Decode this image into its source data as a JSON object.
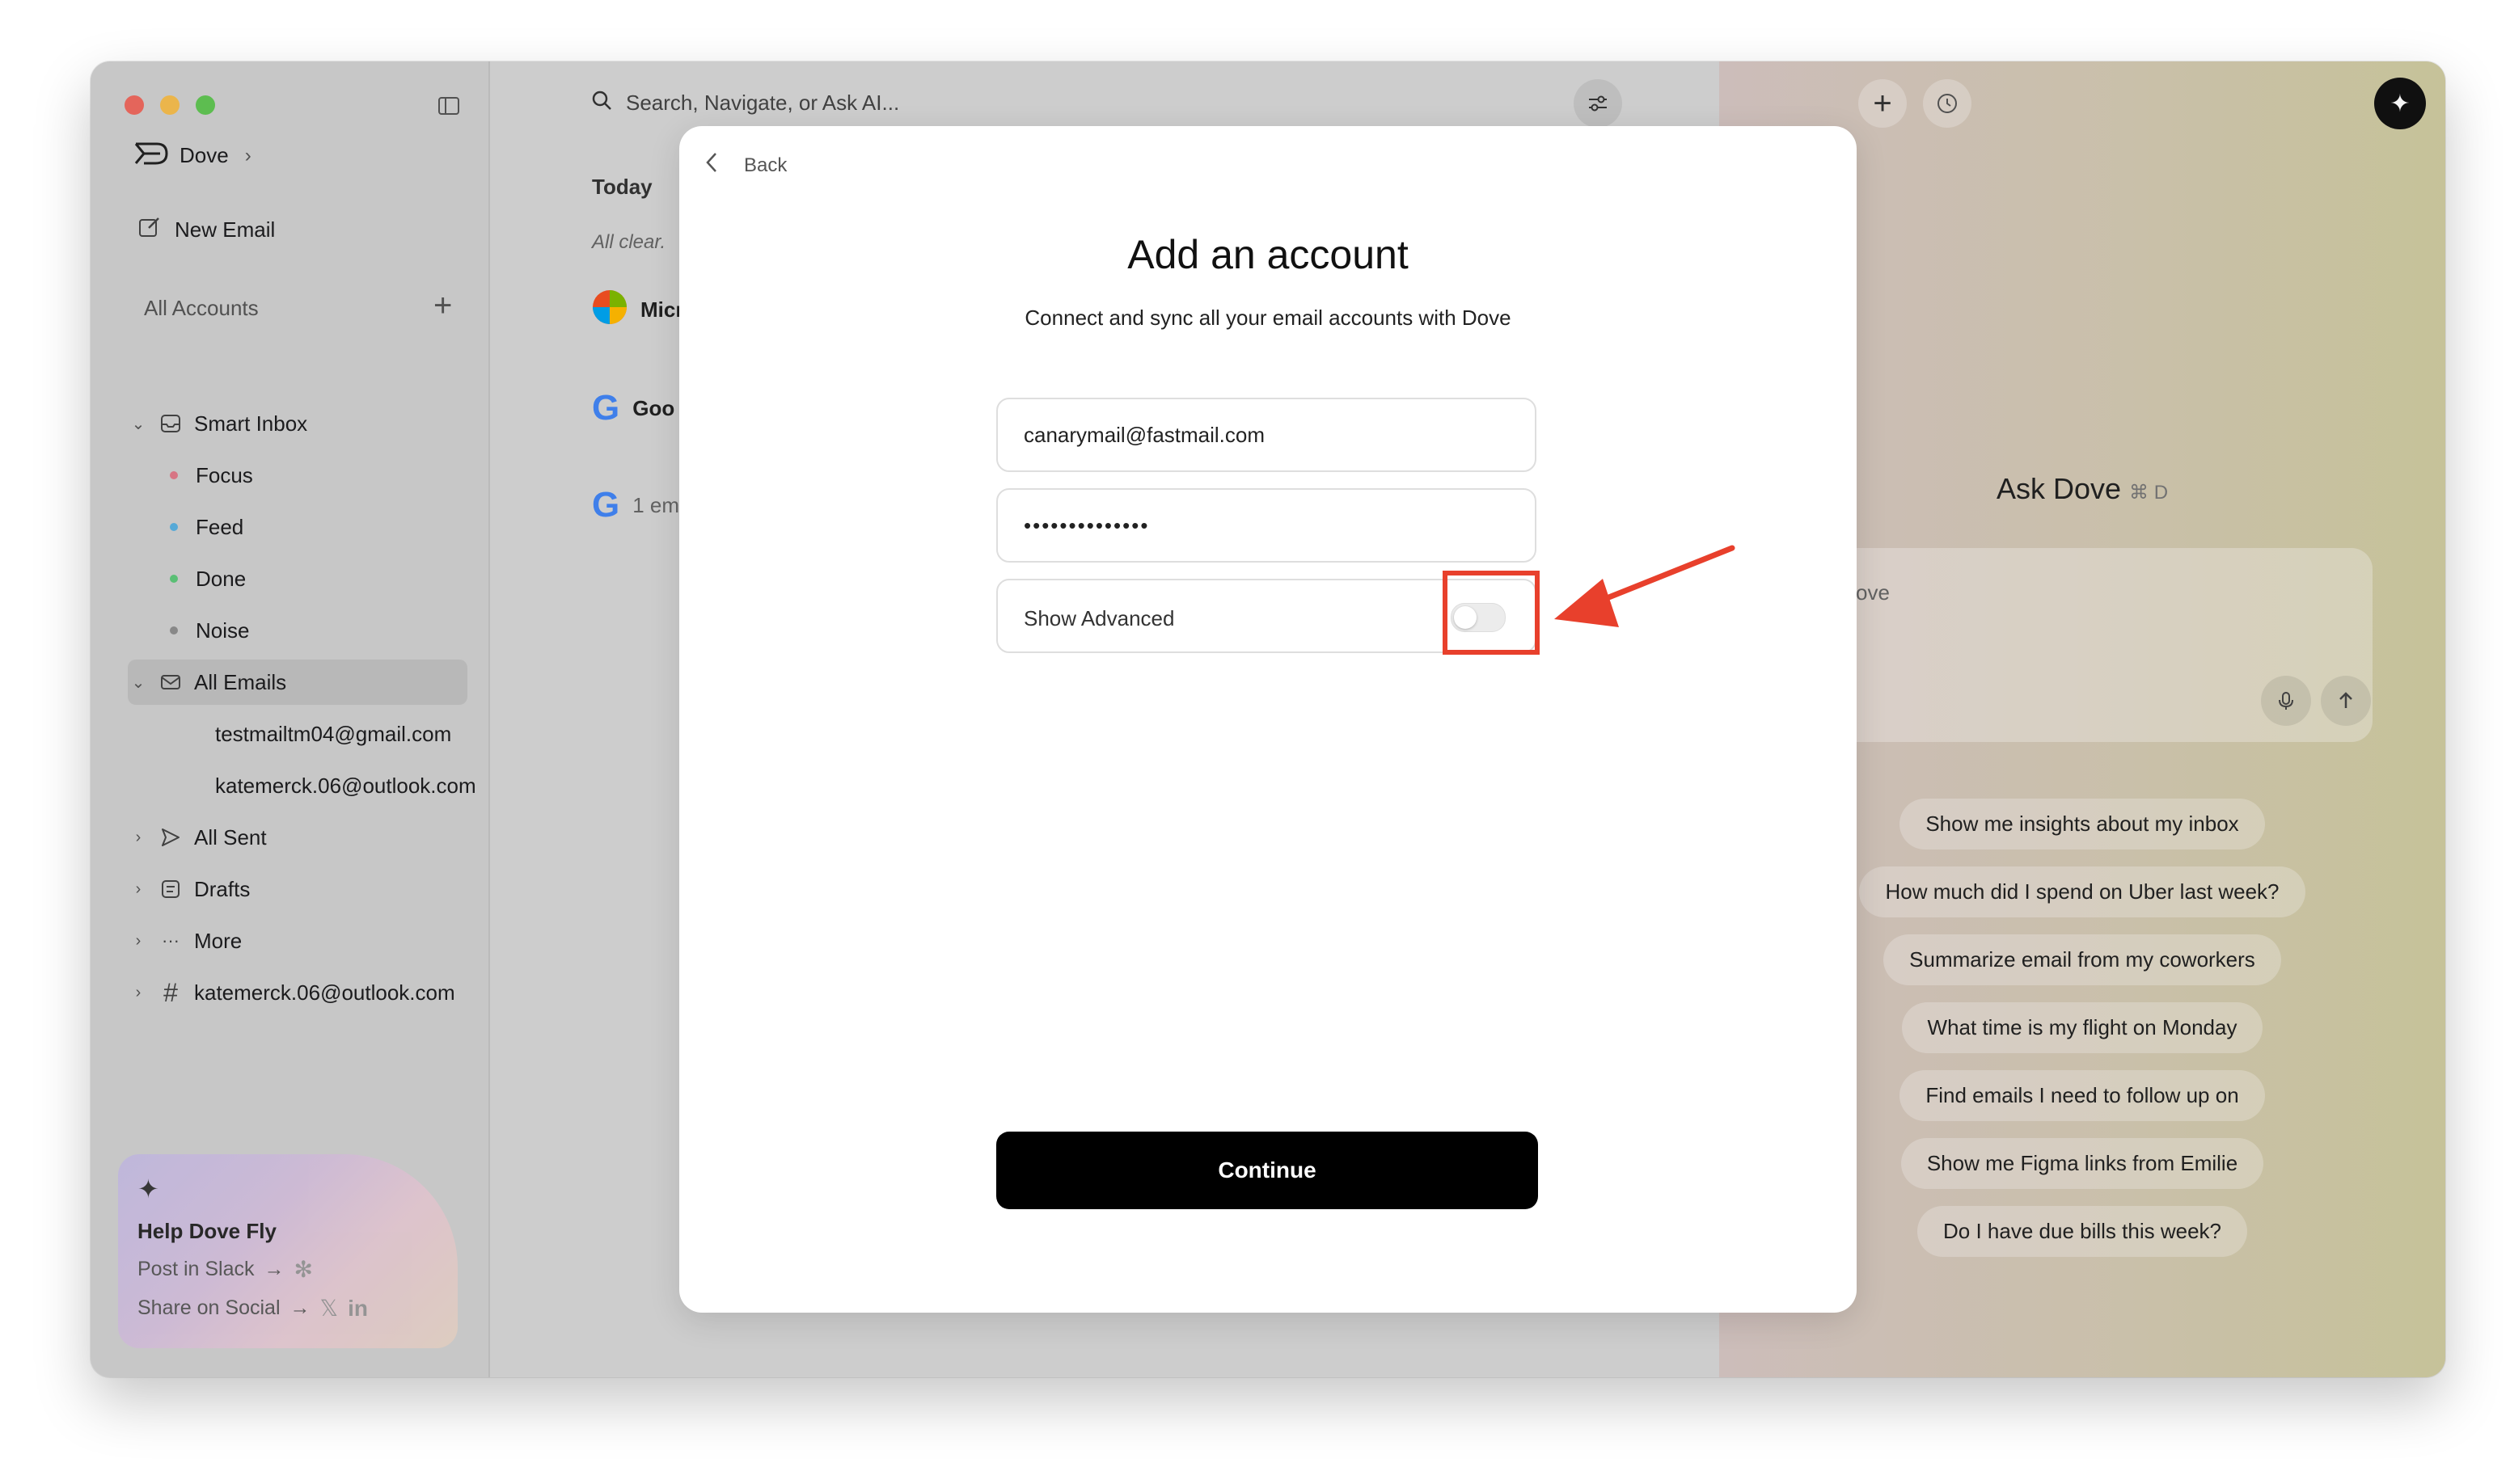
{
  "brand": {
    "name": "Dove"
  },
  "sidebar": {
    "new_email": "New Email",
    "accounts_label": "All Accounts",
    "items": [
      {
        "label": "Smart Inbox"
      },
      {
        "label": "Focus",
        "color": "#e07a8a"
      },
      {
        "label": "Feed",
        "color": "#5ab0e0"
      },
      {
        "label": "Done",
        "color": "#5ec77a"
      },
      {
        "label": "Noise",
        "color": "#8e8e8e"
      },
      {
        "label": "All Emails"
      },
      {
        "label": "testmailtm04@gmail.com"
      },
      {
        "label": "katemerck.06@outlook.com"
      },
      {
        "label": "All Sent"
      },
      {
        "label": "Drafts"
      },
      {
        "label": "More"
      },
      {
        "label": "katemerck.06@outlook.com"
      }
    ],
    "promo": {
      "title": "Help Dove Fly",
      "post_slack": "Post in Slack",
      "share_social": "Share on Social"
    }
  },
  "main": {
    "search_placeholder": "Search, Navigate, or Ask AI...",
    "today": "Today",
    "all_clear": "All clear.",
    "rows": [
      {
        "text": "Micı"
      },
      {
        "text": "Goo"
      },
      {
        "text": "1 em"
      }
    ]
  },
  "ask": {
    "title": "Ask Dove",
    "shortcut": "⌘ D",
    "placeholder": "k Dove",
    "suggestions": [
      "Show me insights about my inbox",
      "How much did I spend on Uber last week?",
      "Summarize email from my coworkers",
      "What time is my flight on Monday",
      "Find emails I need to follow up on",
      "Show me Figma links from Emilie",
      "Do I have due bills this week?"
    ]
  },
  "modal": {
    "back": "Back",
    "title": "Add an account",
    "subtitle": "Connect and sync all your email accounts with Dove",
    "email_value": "canarymail@fastmail.com",
    "password_value": "••••••••••••••",
    "show_advanced": "Show Advanced",
    "show_advanced_on": false,
    "continue": "Continue"
  },
  "colors": {
    "annotation": "#e8402c",
    "primary_button": "#000000"
  }
}
